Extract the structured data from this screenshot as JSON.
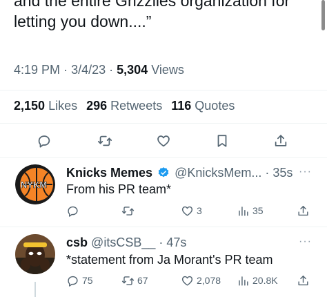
{
  "tweet": {
    "text": "and the entire Grizzlies organization for letting you down....”",
    "time": "4:19 PM",
    "date": "3/4/23",
    "views_count": "5,304",
    "views_label": "Views",
    "likes_count": "2,150",
    "likes_label": "Likes",
    "retweets_count": "296",
    "retweets_label": "Retweets",
    "quotes_count": "116",
    "quotes_label": "Quotes"
  },
  "replies": [
    {
      "name": "Knicks Memes",
      "handle": "@KnicksMem...",
      "time": "35s",
      "verified": true,
      "avatar_text": "NYKM",
      "text": "From his PR team*",
      "reply_count": "",
      "retweet_count": "",
      "like_count": "3",
      "view_count": "35"
    },
    {
      "name": "csb",
      "handle": "@itsCSB__",
      "time": "47s",
      "verified": false,
      "text": "*statement from Ja Morant's PR team",
      "reply_count": "75",
      "retweet_count": "67",
      "like_count": "2,078",
      "view_count": "20.8K"
    }
  ],
  "colors": {
    "text": "#0f1419",
    "secondary": "#536471",
    "verified": "#1d9bf0",
    "divider": "#eff3f4",
    "avatar_orange": "#f58426"
  },
  "icons": [
    "reply-icon",
    "retweet-icon",
    "like-icon",
    "bookmark-icon",
    "share-icon",
    "views-icon",
    "verified-badge-icon",
    "more-icon"
  ]
}
